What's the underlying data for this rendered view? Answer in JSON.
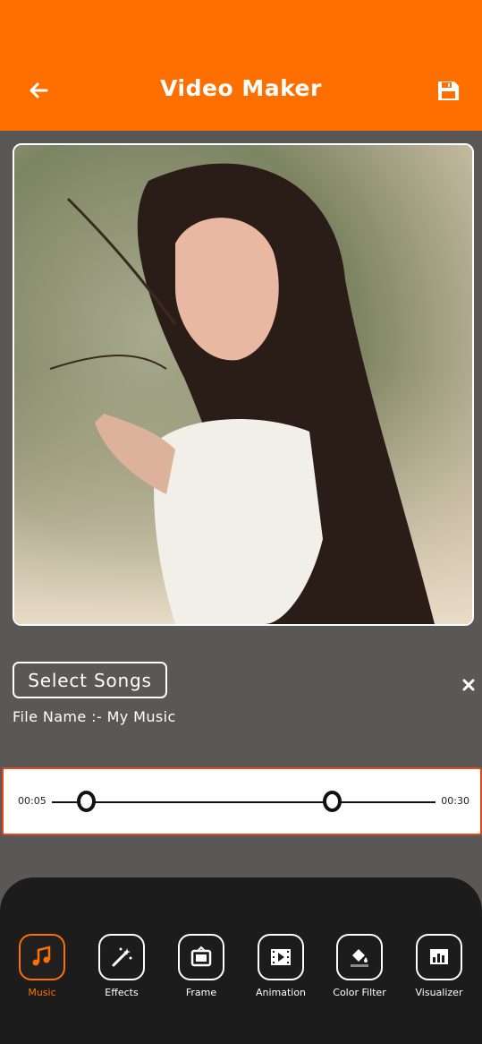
{
  "header": {
    "title": "Video Maker",
    "back_icon": "arrow-left-icon",
    "save_icon": "save-icon"
  },
  "colors": {
    "accent": "#ff6f00",
    "background": "#5a5856",
    "panel": "#1c1c1c",
    "trim_border": "#e8461c"
  },
  "music": {
    "select_label": "Select Songs",
    "file_name": "File Name :- My Music",
    "start_time": "00:05",
    "end_time": "00:30"
  },
  "tools": [
    {
      "label": "Music",
      "icon": "music-note-icon",
      "active": true
    },
    {
      "label": "Effects",
      "icon": "magic-wand-icon",
      "active": false
    },
    {
      "label": "Frame",
      "icon": "frame-icon",
      "active": false
    },
    {
      "label": "Animation",
      "icon": "film-play-icon",
      "active": false
    },
    {
      "label": "Color Filter",
      "icon": "paint-bucket-icon",
      "active": false
    },
    {
      "label": "Visualizer",
      "icon": "bar-chart-icon",
      "active": false
    }
  ]
}
